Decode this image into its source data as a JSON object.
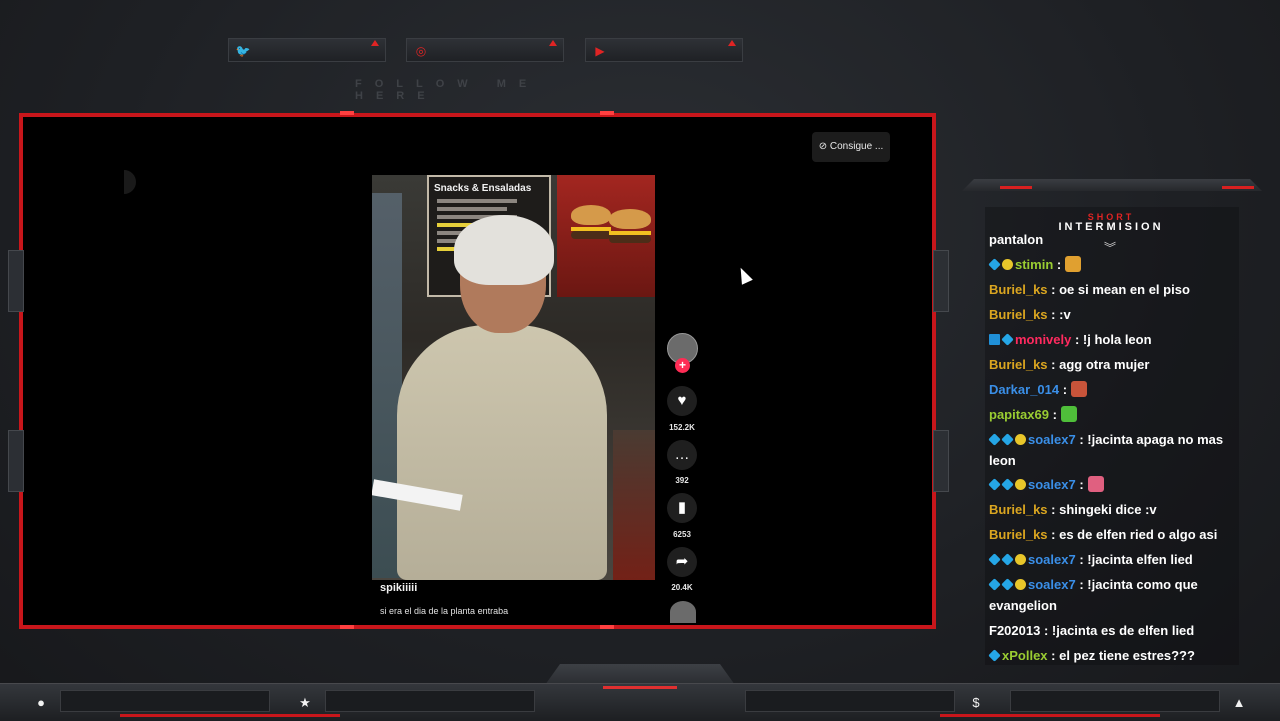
{
  "social": {
    "follow_text": "FOLLOW ME HERE",
    "buttons": [
      {
        "icon": "twitter-icon",
        "glyph": "🐦"
      },
      {
        "icon": "instagram-icon",
        "glyph": "◎"
      },
      {
        "icon": "youtube-icon",
        "glyph": "▶"
      }
    ]
  },
  "player": {
    "consigue_label": "Consigue ...",
    "menu_board_title": "Snacks & Ensaladas",
    "username": "spikiiiii",
    "caption": "si era el dia de la planta entraba",
    "actions": [
      {
        "name": "like",
        "icon": "heart-icon",
        "glyph": "♥",
        "count": "152.2K"
      },
      {
        "name": "comment",
        "icon": "comment-icon",
        "glyph": "…",
        "count": "392"
      },
      {
        "name": "save",
        "icon": "bookmark-icon",
        "glyph": "▮",
        "count": "6253"
      },
      {
        "name": "share",
        "icon": "share-icon",
        "glyph": "➦",
        "count": "20.4K"
      }
    ]
  },
  "chat": {
    "header_small": "SHORT",
    "header_big": "INTERMISION",
    "messages": [
      {
        "user": "",
        "color": "#ffffff",
        "text": "pantalon",
        "badges": []
      },
      {
        "user": "stimin",
        "color": "#9acd32",
        "text": ":",
        "badges": [
          "blue",
          "gold"
        ],
        "emote": "#e0a030"
      },
      {
        "user": "Buriel_ks",
        "color": "#daa520",
        "text": ": oe si mean en el piso",
        "badges": []
      },
      {
        "user": "Buriel_ks",
        "color": "#daa520",
        "text": ": :v",
        "badges": []
      },
      {
        "user": "monively",
        "color": "#ff2a5f",
        "text": ": !j hola leon",
        "badges": [
          "sq",
          "blue"
        ]
      },
      {
        "user": "Buriel_ks",
        "color": "#daa520",
        "text": ": agg otra mujer",
        "badges": []
      },
      {
        "user": "Darkar_014",
        "color": "#3a8fe8",
        "text": ":",
        "badges": [],
        "emote": "#c8543a"
      },
      {
        "user": "papitax69",
        "color": "#9acd32",
        "text": ":",
        "badges": [],
        "emote": "#4fbf3a"
      },
      {
        "user": "soalex7",
        "color": "#3a8fe8",
        "text": ": !jacinta apaga no mas leon",
        "badges": [
          "blue",
          "blue",
          "gold"
        ]
      },
      {
        "user": "soalex7",
        "color": "#3a8fe8",
        "text": ":",
        "badges": [
          "blue",
          "blue",
          "gold"
        ],
        "emote": "#e06080"
      },
      {
        "user": "Buriel_ks",
        "color": "#daa520",
        "text": ": shingeki dice :v",
        "badges": []
      },
      {
        "user": "Buriel_ks",
        "color": "#daa520",
        "text": ": es de elfen ried o algo asi",
        "badges": []
      },
      {
        "user": "soalex7",
        "color": "#3a8fe8",
        "text": ": !jacinta elfen lied",
        "badges": [
          "blue",
          "blue",
          "gold"
        ]
      },
      {
        "user": "soalex7",
        "color": "#3a8fe8",
        "text": ": !jacinta como que evangelion",
        "badges": [
          "blue",
          "blue",
          "gold"
        ]
      },
      {
        "user": "F202013",
        "color": "#ffffff",
        "text": ": !jacinta es de elfen lied",
        "badges": []
      },
      {
        "user": "xPollex",
        "color": "#9acd32",
        "text": ": el pez tiene estres???",
        "badges": [
          "blue"
        ]
      }
    ]
  },
  "bottom": {
    "icons": [
      {
        "icon": "user-icon",
        "glyph": "●"
      },
      {
        "icon": "star-icon",
        "glyph": "★"
      },
      {
        "icon": "dollar-icon",
        "glyph": "$"
      },
      {
        "icon": "rocket-icon",
        "glyph": "▲"
      }
    ]
  },
  "colors": {
    "accent": "#c8161b",
    "background": "#1e2024"
  }
}
